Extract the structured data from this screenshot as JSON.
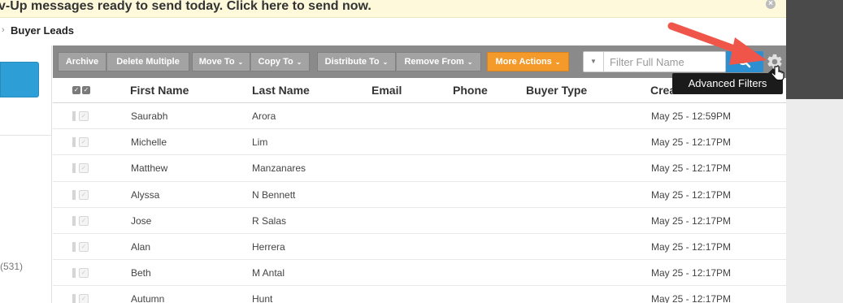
{
  "banner": {
    "text": "v-Up messages ready to send today. Click here to send now.",
    "close_glyph": "×"
  },
  "breadcrumb": {
    "separator": "›",
    "title": "Buyer Leads"
  },
  "left_panel": {
    "count_text": "(531)"
  },
  "toolbar": {
    "archive": "Archive",
    "delete_multiple": "Delete Multiple",
    "move_to": "Move To",
    "copy_to": "Copy To",
    "distribute_to": "Distribute To",
    "remove_from": "Remove From",
    "more_actions": "More Actions",
    "caret": "⌄",
    "accent_color": "#f39a2b"
  },
  "search": {
    "placeholder": "Filter Full Name",
    "value": "",
    "dropdown_glyph": "▼",
    "button_icon": "search-icon",
    "button_color": "#2b8fd2"
  },
  "advanced_filters": {
    "icon": "gear-icon",
    "tooltip": "Advanced Filters"
  },
  "table": {
    "headers": {
      "first_name": "First Name",
      "last_name": "Last Name",
      "email": "Email",
      "phone": "Phone",
      "buyer_type": "Buyer Type",
      "created_at": "Created At"
    },
    "rows": [
      {
        "first": "Saurabh",
        "last": "Arora",
        "email": "",
        "phone": "",
        "buyer_type": "",
        "created": "May 25 - 12:59PM"
      },
      {
        "first": "Michelle",
        "last": "Lim",
        "email": "",
        "phone": "",
        "buyer_type": "",
        "created": "May 25 - 12:17PM"
      },
      {
        "first": "Matthew",
        "last": "Manzanares",
        "email": "",
        "phone": "",
        "buyer_type": "",
        "created": "May 25 - 12:17PM"
      },
      {
        "first": "Alyssa",
        "last": "N Bennett",
        "email": "",
        "phone": "",
        "buyer_type": "",
        "created": "May 25 - 12:17PM"
      },
      {
        "first": "Jose",
        "last": "R Salas",
        "email": "",
        "phone": "",
        "buyer_type": "",
        "created": "May 25 - 12:17PM"
      },
      {
        "first": "Alan",
        "last": "Herrera",
        "email": "",
        "phone": "",
        "buyer_type": "",
        "created": "May 25 - 12:17PM"
      },
      {
        "first": "Beth",
        "last": "M Antal",
        "email": "",
        "phone": "",
        "buyer_type": "",
        "created": "May 25 - 12:17PM"
      },
      {
        "first": "Autumn",
        "last": "Hunt",
        "email": "",
        "phone": "",
        "buyer_type": "",
        "created": "May 25 - 12:17PM"
      }
    ]
  },
  "annotation": {
    "arrow_color": "#f0554a"
  }
}
